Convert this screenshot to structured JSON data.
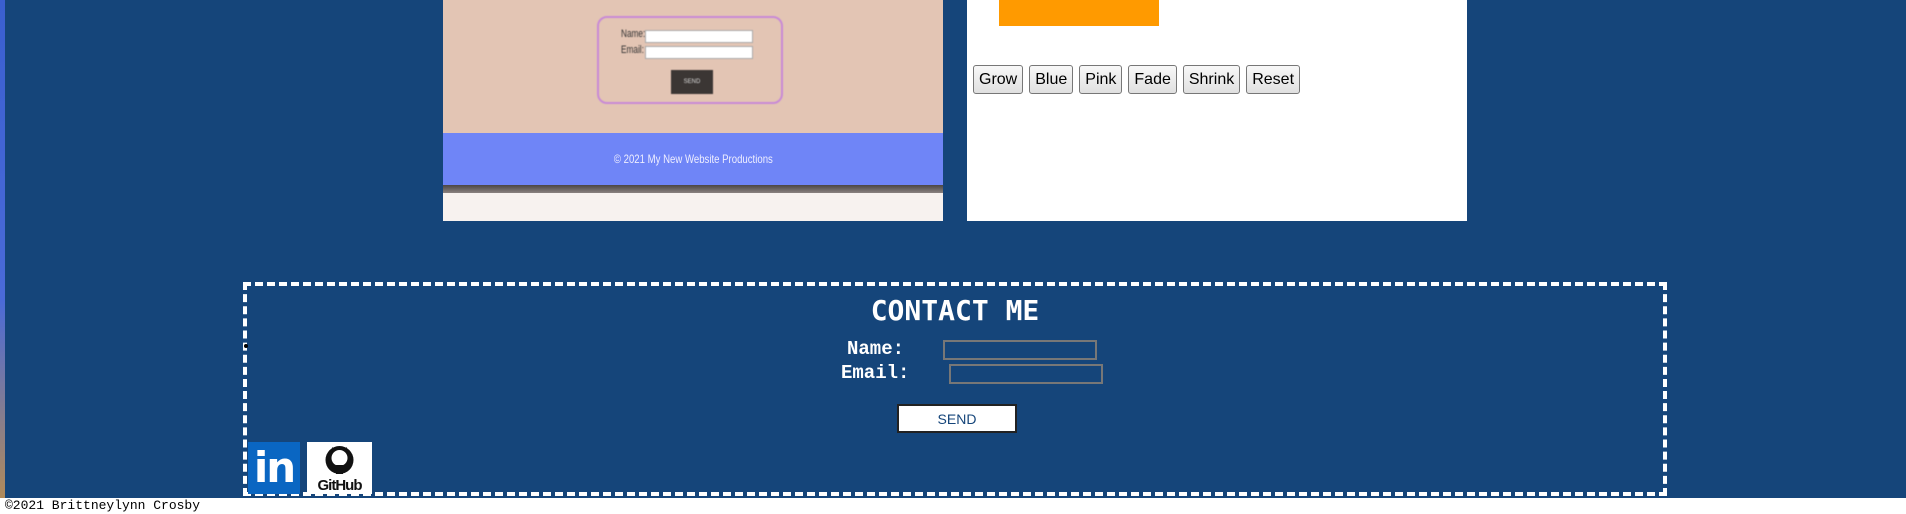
{
  "project_preview": {
    "name_label": "Name:",
    "email_label": "Email:",
    "send_label": "SEND",
    "footer_text": "© 2021 My New Website Productions"
  },
  "demo": {
    "box_color": "#ff9a00",
    "buttons": [
      "Grow",
      "Blue",
      "Pink",
      "Fade",
      "Shrink",
      "Reset"
    ]
  },
  "contact": {
    "title": "CONTACT ME",
    "name_label": "Name:",
    "email_label": "Email:",
    "send_label": "SEND",
    "social": {
      "linkedin_text": "in",
      "github_text": "GitHub"
    }
  },
  "footer": {
    "copyright": "©2021 Brittneylynn Crosby"
  },
  "colors": {
    "background": "#15457a",
    "linkedin": "#0a66c2",
    "preview_footer": "#6f85f7"
  }
}
